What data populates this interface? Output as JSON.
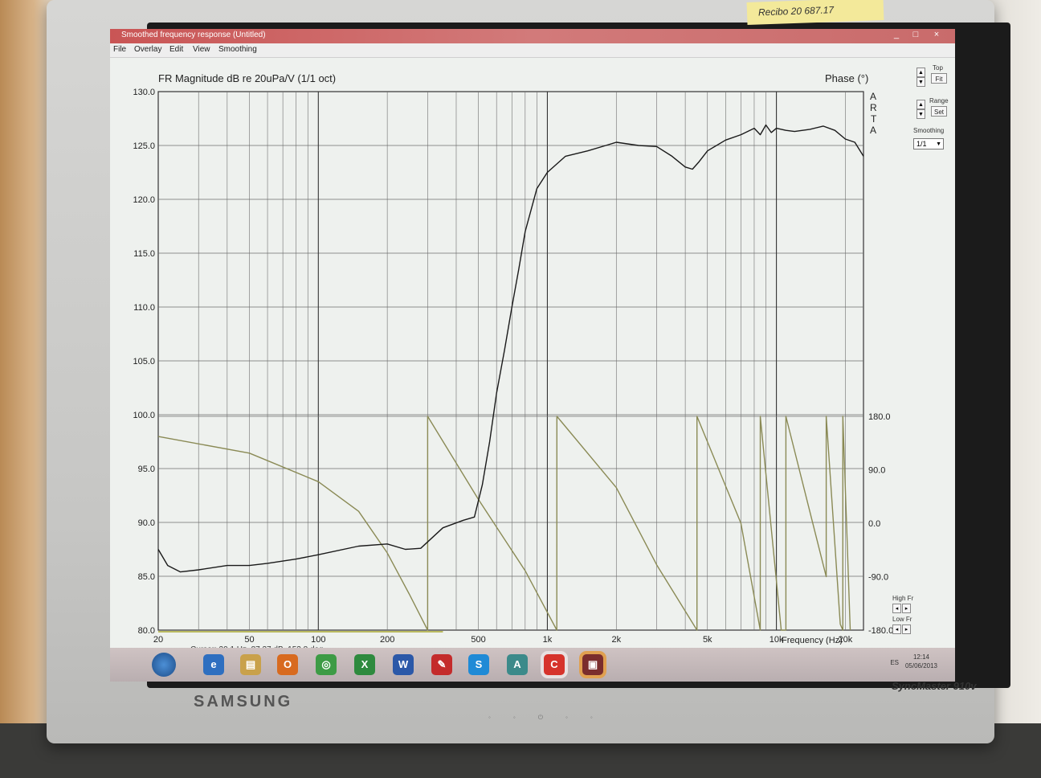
{
  "window": {
    "title": "Smoothed frequency response (Untitled)",
    "controls": [
      "_",
      "□",
      "×"
    ]
  },
  "menu": [
    "File",
    "Overlay",
    "Edit",
    "View",
    "Smoothing"
  ],
  "plot": {
    "left_title": "FR Magnitude dB re 20uPa/V (1/1 oct)",
    "right_title": "Phase (°)",
    "watermark": [
      "A",
      "R",
      "T",
      "A"
    ],
    "x_axis_label": "Frequency (Hz)",
    "y_left_ticks": [
      "130.0",
      "125.0",
      "120.0",
      "115.0",
      "110.0",
      "105.0",
      "100.0",
      "95.0",
      "90.0",
      "85.0",
      "80.0"
    ],
    "y_right_ticks": [
      "180.0",
      "90.0",
      "0.0",
      "-90.0",
      "-180.0"
    ],
    "x_tick_labels": [
      "20",
      "50",
      "100",
      "200",
      "500",
      "1k",
      "2k",
      "5k",
      "10k",
      "20k"
    ],
    "colors": {
      "magnitude": "#1a1a1a",
      "phase": "#8a8a55",
      "grid": "#6e6e6e",
      "background": "#eef1ee"
    }
  },
  "chart_data": {
    "type": "line",
    "x_scale": "log",
    "xlim": [
      20,
      24000
    ],
    "ylim_left": [
      80,
      130
    ],
    "ylim_right": [
      -180,
      180
    ],
    "grid": true,
    "series": [
      {
        "axis": "left",
        "x": [
          20,
          22,
          25,
          30,
          40,
          50,
          60,
          80,
          100,
          150,
          200,
          240,
          280,
          350,
          430,
          480,
          520,
          560,
          600,
          650,
          700,
          750,
          800,
          900,
          1000,
          1200,
          1500,
          1800,
          2000,
          2500,
          3000,
          3500,
          4000,
          4300,
          4600,
          5000,
          6000,
          7000,
          8000,
          8500,
          9000,
          9500,
          10000,
          11000,
          12000,
          14000,
          16000,
          18000,
          20000,
          22000,
          24000
        ],
        "y": [
          87.5,
          86.0,
          85.4,
          85.6,
          86.0,
          86.0,
          86.2,
          86.6,
          87.0,
          87.8,
          88.0,
          87.5,
          87.6,
          89.5,
          90.2,
          90.5,
          93.5,
          97.5,
          102.0,
          106.0,
          110.0,
          113.5,
          117.0,
          121.0,
          122.5,
          124.0,
          124.5,
          125.0,
          125.3,
          125.0,
          124.9,
          124.0,
          123.0,
          122.8,
          123.5,
          124.5,
          125.5,
          126.0,
          126.6,
          126.0,
          126.9,
          126.2,
          126.6,
          126.4,
          126.3,
          126.5,
          126.8,
          126.4,
          125.6,
          125.3,
          124.0
        ]
      },
      {
        "axis": "right",
        "x": [
          20,
          50,
          100,
          150,
          200,
          250,
          300,
          300.1,
          500,
          800,
          1100,
          1100.1,
          2000,
          3000,
          4500,
          4500.1,
          7000,
          8500,
          8500.1,
          10500,
          11000,
          11000.1,
          16500,
          16500.1,
          19000,
          19500,
          19500.1,
          21000
        ],
        "y": [
          146,
          118,
          70,
          20,
          -50,
          -120,
          -180,
          180,
          40,
          -80,
          -180,
          180,
          60,
          -70,
          -180,
          180,
          0,
          -180,
          180,
          -180,
          -180,
          180,
          -90,
          180,
          -170,
          -180,
          180,
          -180
        ]
      }
    ]
  },
  "panel": {
    "top_label": "Top",
    "fit_label": "Fit",
    "range_label": "Range",
    "set_label": "Set",
    "smoothing_label": "Smoothing",
    "smoothing_value": "1/1",
    "high_fr_label": "High Fr",
    "low_fr_label": "Low Fr"
  },
  "status": {
    "cursor": "Cursor: 20.1 Hz, 87.37 dB, 153.8 deg"
  },
  "taskbar": {
    "icons": [
      "e",
      "▤",
      "O",
      "◎",
      "X",
      "W",
      "✎",
      "S",
      "A",
      "C",
      "▣"
    ],
    "clock_time": "12:14",
    "clock_date": "05/06/2013",
    "tray_lang": "ES"
  },
  "monitor": {
    "brand": "SAMSUNG",
    "model": "SyncMaster 910v"
  },
  "sticky_note": "Recibo 20 687.17"
}
